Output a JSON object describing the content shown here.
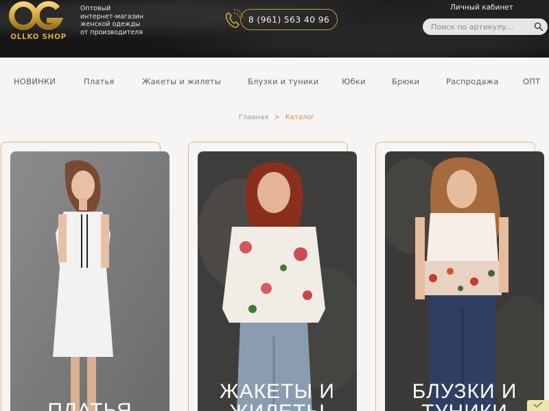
{
  "brand": {
    "logo_text": "OLLKO SHOP",
    "tagline": [
      "Оптовый",
      "интернет-магазин",
      "женской одежды",
      "от производителя"
    ],
    "gold": "#d4a73a"
  },
  "header": {
    "phone": "8 (961) 563 40 96",
    "cabinet_label": "Личный кабинет",
    "search_placeholder": "Поиск по артикулу..."
  },
  "nav": {
    "items": [
      "НОВИНКИ",
      "Платья",
      "Жакеты и жилеты",
      "Блузки и туники",
      "Юбки",
      "Брюки",
      "Распродажа",
      "ОПТ"
    ]
  },
  "breadcrumb": {
    "home": "Главная",
    "separator": ">",
    "current": "Каталог"
  },
  "catalog": {
    "cards": [
      {
        "title": "ПЛАТЬЯ",
        "icon": "dress-photo"
      },
      {
        "title": "ЖАКЕТЫ И ЖИЛЕТЫ",
        "icon": "jacket-photo"
      },
      {
        "title": "БЛУЗКИ И ТУНИКИ",
        "icon": "blouse-photo"
      }
    ]
  },
  "colors": {
    "header_bg": "#151515",
    "accent": "#c99a36",
    "breadcrumb_current": "#d08a52",
    "card_border": "#d9b98a"
  }
}
